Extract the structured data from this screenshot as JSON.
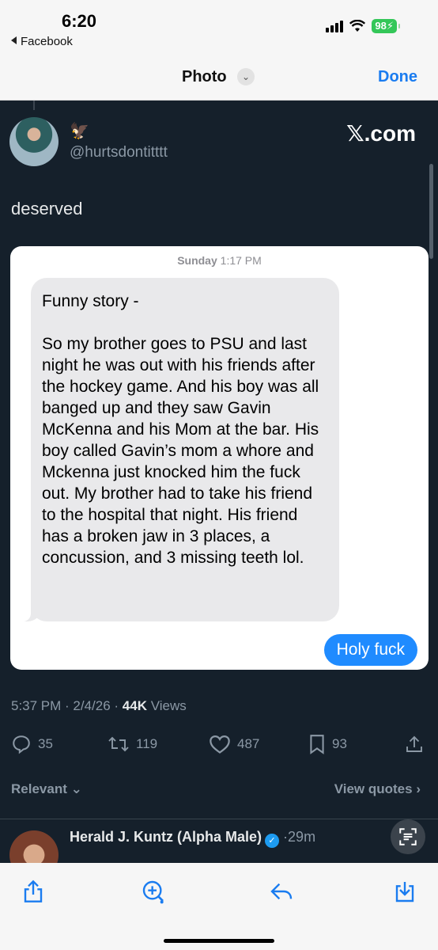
{
  "status_bar": {
    "time": "6:20",
    "back_app": "Facebook",
    "battery": "98"
  },
  "nav": {
    "title": "Photo",
    "chevron": "⌄",
    "done_label": "Done"
  },
  "post": {
    "brand": "com",
    "brand_x": "𝕏",
    "handle": "@hurtsdontitttt",
    "text": "deserved",
    "timestamp": "5:37 PM · 2/4/26 · ",
    "views_count": "44K",
    "views_label": " Views",
    "stats": {
      "replies": "35",
      "reposts": "119",
      "likes": "487",
      "bookmarks": "93"
    },
    "relevant_label": "Relevant",
    "view_quotes_label": "View quotes"
  },
  "messages": {
    "date_day": "Sunday",
    "date_time": "1:17 PM",
    "incoming": "Funny story -\n\nSo my brother goes to PSU and last night he was out with his friends after the hockey game. And his boy was all banged up and they saw Gavin McKenna and his Mom at the bar. His boy called Gavin’s mom a whore and Mckenna just knocked him the fuck out. My brother had to take his friend to the hospital that night. His friend has a broken jaw in 3 places, a concussion, and 3 missing teeth lol.",
    "outgoing": "Holy fuck"
  },
  "reply": {
    "name": "Herald J. Kuntz (Alpha Male)",
    "time": "·29m"
  },
  "icons": [
    "back-triangle-icon",
    "signal-icon",
    "wifi-icon",
    "battery-icon",
    "chevron-down-icon",
    "eagle-icon",
    "reply-icon",
    "repost-icon",
    "like-icon",
    "bookmark-icon",
    "share-icon",
    "verified-icon",
    "scan-text-icon",
    "share-out-icon",
    "markup-icon",
    "reply-arrow-icon",
    "save-icon"
  ],
  "colors": {
    "accent": "#1a7cf0",
    "tweet_bg": "#15202b",
    "bubble_out": "#1f8bff",
    "battery": "#34c759"
  }
}
